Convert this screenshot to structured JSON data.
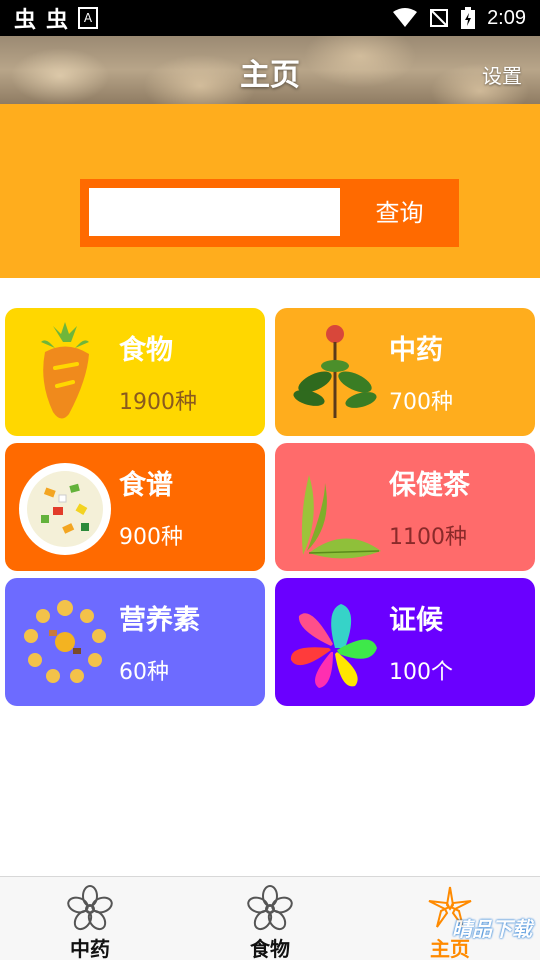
{
  "status_bar": {
    "left_icons": [
      "app-icon-1",
      "app-icon-2",
      "a-icon"
    ],
    "left_glyph_1": "虫",
    "left_glyph_2": "虫",
    "a_glyph": "A",
    "right_icons": [
      "wifi-icon",
      "no-signal-icon",
      "battery-charging-icon"
    ],
    "time": "2:09"
  },
  "header": {
    "title": "主页",
    "settings_label": "设置"
  },
  "search": {
    "placeholder": "",
    "value": "",
    "button_label": "查询"
  },
  "cards": [
    {
      "title": "食物",
      "count": "1900种",
      "icon": "carrot-icon",
      "bg": "#ffd700",
      "count_color": "#8a5a1e"
    },
    {
      "title": "中药",
      "count": "700种",
      "icon": "herb-plant-icon",
      "bg": "#ffad1d",
      "count_color": "#ffffff"
    },
    {
      "title": "食谱",
      "count": "900种",
      "icon": "salad-plate-icon",
      "bg": "#ff6a00",
      "count_color": "#ffffff"
    },
    {
      "title": "保健茶",
      "count": "1100种",
      "icon": "tea-leaf-icon",
      "bg": "#ff6b6b",
      "count_color": "#8a2a2a"
    },
    {
      "title": "营养素",
      "count": "60种",
      "icon": "vitamins-icon",
      "bg": "#6d6bff",
      "count_color": "#ffffff"
    },
    {
      "title": "证候",
      "count": "100个",
      "icon": "petal-flower-icon",
      "bg": "#6a00ff",
      "count_color": "#ffffff"
    }
  ],
  "bottom_nav": [
    {
      "label": "中药",
      "icon": "flower-outline-icon",
      "color": "#111111",
      "active": false
    },
    {
      "label": "食物",
      "icon": "flower-outline-icon",
      "color": "#111111",
      "active": false
    },
    {
      "label": "主页",
      "icon": "flower-outline-icon",
      "color": "#ff8a00",
      "active": true
    }
  ],
  "watermark": "晴品下载"
}
